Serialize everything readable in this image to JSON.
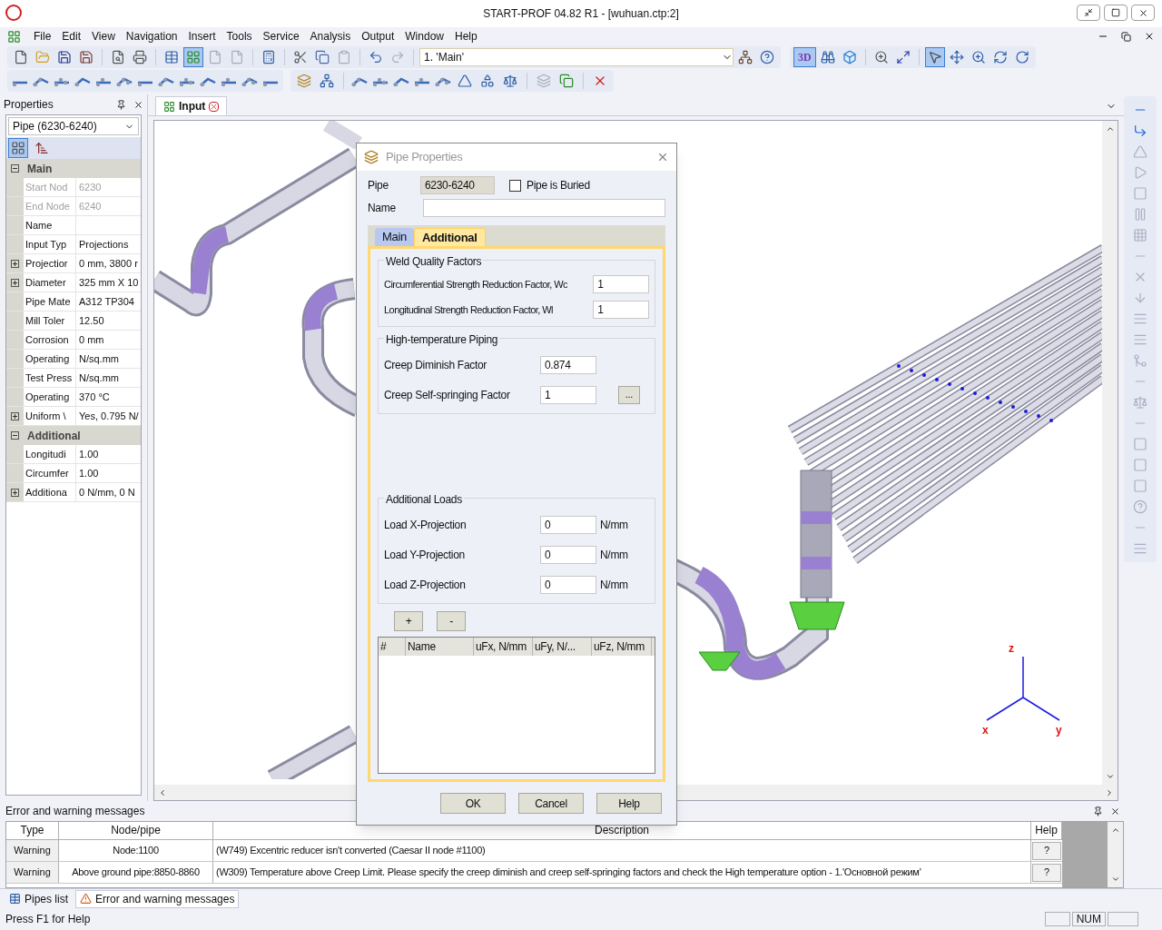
{
  "window": {
    "title": "START-PROF 04.82 R1 - [wuhuan.ctp:2]"
  },
  "menu": [
    "File",
    "Edit",
    "View",
    "Navigation",
    "Insert",
    "Tools",
    "Service",
    "Analysis",
    "Output",
    "Window",
    "Help"
  ],
  "toolbar": {
    "view_combo": "1. 'Main'",
    "mode_3d": {
      "label": "3D",
      "on": true
    }
  },
  "properties": {
    "title": "Properties",
    "object": "Pipe (6230-6240)",
    "sections": [
      {
        "label": "Main",
        "expanded": true,
        "rows": [
          {
            "name": "Start Nod",
            "value": "6230",
            "disabled": true,
            "expandable": false
          },
          {
            "name": "End Node",
            "value": "6240",
            "disabled": true,
            "expandable": false
          },
          {
            "name": "Name",
            "disabled": false,
            "expandable": false
          },
          {
            "name": "Input Typ",
            "value": "Projections",
            "disabled": false,
            "expandable": false
          },
          {
            "name": "Projectior",
            "value": "0 mm, 3800 r",
            "disabled": false,
            "expandable": true
          },
          {
            "name": "Diameter",
            "value": "325 mm X 10",
            "disabled": false,
            "expandable": true
          },
          {
            "name": "Pipe Mate",
            "value": "A312 TP304",
            "disabled": false,
            "expandable": false
          },
          {
            "name": "Mill Toler",
            "value": "12.50",
            "disabled": false,
            "expandable": false
          },
          {
            "name": "Corrosion",
            "value": "0 mm",
            "disabled": false,
            "expandable": false
          },
          {
            "name": "Operating",
            "value": "N/sq.mm",
            "disabled": false,
            "expandable": false
          },
          {
            "name": "Test Press",
            "value": "N/sq.mm",
            "disabled": false,
            "expandable": false
          },
          {
            "name": "Operating",
            "value": "370 °C",
            "disabled": false,
            "expandable": false
          },
          {
            "name": "Uniform \\",
            "value": "Yes, 0.795 N/",
            "disabled": false,
            "expandable": true
          }
        ]
      },
      {
        "label": "Additional",
        "expanded": true,
        "rows": [
          {
            "name": "Longitudi",
            "value": "1.00",
            "disabled": false,
            "expandable": false
          },
          {
            "name": "Circumfer",
            "value": "1.00",
            "disabled": false,
            "expandable": false
          },
          {
            "name": "Additiona",
            "value": "0 N/mm, 0 N",
            "disabled": false,
            "expandable": true
          }
        ]
      }
    ]
  },
  "document_tab": {
    "label": "Input"
  },
  "viewport": {
    "axis_labels": {
      "z": "z",
      "x": "x",
      "y": "y"
    }
  },
  "dialog": {
    "title": "Pipe Properties",
    "pipe_label": "Pipe",
    "pipe_value": "6230-6240",
    "buried": {
      "label": "Pipe is Buried",
      "checked": false
    },
    "name_label": "Name",
    "tabs": [
      {
        "label": "Main",
        "selected": false
      },
      {
        "label": "Additional",
        "selected": true
      }
    ],
    "groups": [
      {
        "title": "Weld Quality Factors",
        "kind": "wide",
        "fields": [
          {
            "label": "Circumferential Strength Reduction Factor, Wc",
            "value": "1"
          },
          {
            "label": "Longitudinal Strength Reduction Factor, Wl",
            "value": "1"
          }
        ]
      },
      {
        "title": "High-temperature Piping",
        "kind": "browse",
        "fields": [
          {
            "label": "Creep Diminish Factor",
            "value": "0.874"
          },
          {
            "label": "Creep Self-springing Factor",
            "value": "1",
            "button": "..."
          }
        ]
      },
      {
        "title": "Additional Loads",
        "kind": "units",
        "fields": [
          {
            "label": "Load X-Projection",
            "value": "0",
            "unit": "N/mm"
          },
          {
            "label": "Load Y-Projection",
            "value": "0",
            "unit": "N/mm"
          },
          {
            "label": "Load Z-Projection",
            "value": "0",
            "unit": "N/mm"
          }
        ]
      }
    ],
    "row_buttons": [
      "+",
      "-"
    ],
    "table_columns": [
      "#",
      "Name",
      "uFx, N/mm",
      "uFy, N/...",
      "uFz, N/mm"
    ],
    "buttons": [
      "OK",
      "Cancel",
      "Help"
    ]
  },
  "messages": {
    "title": "Error and warning messages",
    "columns": [
      "Type",
      "Node/pipe",
      "Description",
      "Help"
    ],
    "rows": [
      {
        "type": "Warning",
        "node": "Node:1100",
        "description": "(W749) Excentric reducer isn't converted (Caesar II node #1100)",
        "help": "?"
      },
      {
        "type": "Warning",
        "node": "Above ground pipe:8850-8860",
        "description": "(W309) Temperature above Creep Limit. Please specify the creep diminish and creep self-springing factors and check the High temperature option - 1.'Основной режим'",
        "help": "?"
      }
    ]
  },
  "bottom_tabs": [
    {
      "label": "Pipes list",
      "selected": false
    },
    {
      "label": "Error and warning messages",
      "selected": true
    }
  ],
  "status_bar": {
    "text": "Press F1 for Help",
    "indicators": [
      "NUM"
    ]
  }
}
